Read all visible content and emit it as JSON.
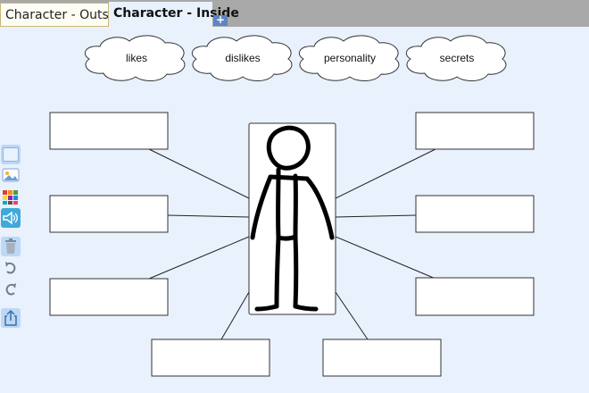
{
  "tabs": [
    {
      "label": "Character - Outside",
      "active": false
    },
    {
      "label": "Character - Inside",
      "active": true
    }
  ],
  "add_tab_label": "+",
  "clouds": [
    {
      "label": "likes"
    },
    {
      "label": "dislikes"
    },
    {
      "label": "personality"
    },
    {
      "label": "secrets"
    }
  ],
  "text_boxes": [
    {
      "name": "trait-box-left-top",
      "value": ""
    },
    {
      "name": "trait-box-left-middle",
      "value": ""
    },
    {
      "name": "trait-box-left-bottom",
      "value": ""
    },
    {
      "name": "trait-box-right-top",
      "value": ""
    },
    {
      "name": "trait-box-right-middle",
      "value": ""
    },
    {
      "name": "trait-box-right-bottom",
      "value": ""
    },
    {
      "name": "trait-box-bottom-left",
      "value": ""
    },
    {
      "name": "trait-box-bottom-right",
      "value": ""
    }
  ],
  "toolbar": [
    {
      "name": "blank-shape-tool",
      "icon": "blank-rectangle-icon"
    },
    {
      "name": "insert-image-tool",
      "icon": "image-icon"
    },
    {
      "name": "color-palette-tool",
      "icon": "palette-icon"
    },
    {
      "name": "audio-tool",
      "icon": "speaker-icon"
    },
    {
      "name": "delete-tool",
      "icon": "trash-icon"
    },
    {
      "name": "undo-tool",
      "icon": "undo-icon"
    },
    {
      "name": "redo-tool",
      "icon": "redo-icon"
    },
    {
      "name": "share-tool",
      "icon": "share-icon"
    }
  ],
  "colors": {
    "accent": "#5e84c4",
    "canvas": "#e9f1fd",
    "tool_bg": "#bcd8f5"
  }
}
